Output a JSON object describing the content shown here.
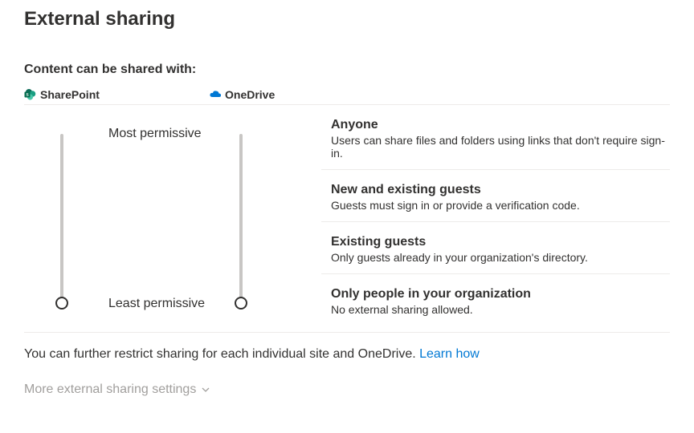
{
  "page": {
    "title": "External sharing",
    "section_title": "Content can be shared with:"
  },
  "products": {
    "sharepoint": "SharePoint",
    "onedrive": "OneDrive"
  },
  "slider_labels": {
    "most": "Most permissive",
    "least": "Least permissive"
  },
  "levels": [
    {
      "title": "Anyone",
      "desc": "Users can share files and folders using links that don't require sign-in."
    },
    {
      "title": "New and existing guests",
      "desc": "Guests must sign in or provide a verification code."
    },
    {
      "title": "Existing guests",
      "desc": "Only guests already in your organization's directory."
    },
    {
      "title": "Only people in your organization",
      "desc": "No external sharing allowed."
    }
  ],
  "footer": {
    "text": "You can further restrict sharing for each individual site and OneDrive. ",
    "learn_label": "Learn how"
  },
  "more_settings_label": "More external sharing settings"
}
